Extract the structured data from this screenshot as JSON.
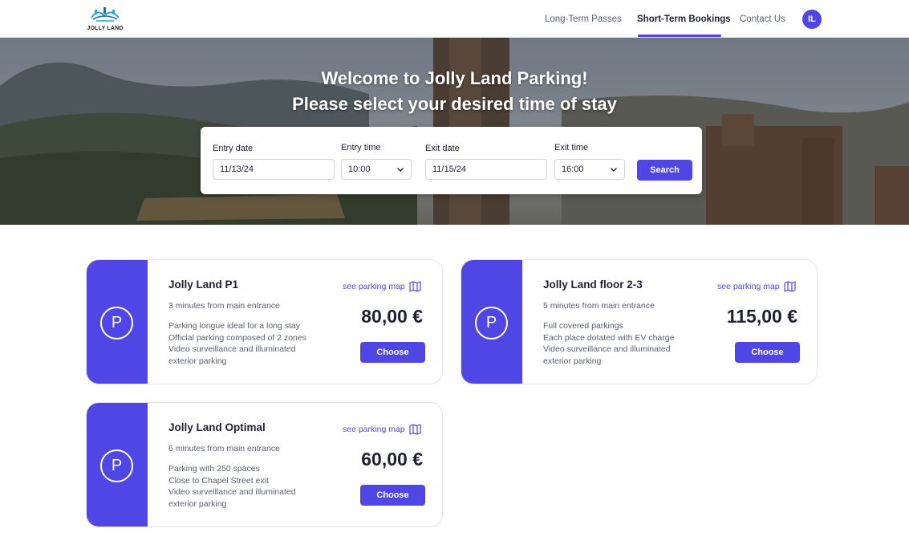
{
  "header": {
    "logo_text": "JOLLY LAND",
    "nav": [
      {
        "label": "Long-Term Passes"
      },
      {
        "label": "Short-Term Bookings"
      },
      {
        "label": "Contact Us"
      }
    ],
    "avatar_initials": "IL",
    "accent_color": "#4f46e5"
  },
  "hero": {
    "title_line1": "Welcome to Jolly Land Parking!",
    "title_line2": "Please select your desired time of stay"
  },
  "search": {
    "entry_date_label": "Entry date",
    "entry_date_value": "11/13/24",
    "entry_time_label": "Entry time",
    "entry_time_value": "10:00",
    "exit_date_label": "Exit date",
    "exit_date_value": "11/15/24",
    "exit_time_label": "Exit time",
    "exit_time_value": "16:00",
    "search_label": "Search"
  },
  "cards": [
    {
      "icon_letter": "P",
      "name": "Jolly Land P1",
      "map_link": "see parking map",
      "distance": "3 minutes from main entrance",
      "desc": [
        "Parking longue ideal for a long stay",
        "Official parking composed of 2 zones",
        "Video surveillance and illuminated",
        "exterior parking"
      ],
      "price": "80,00 €",
      "choose_label": "Choose"
    },
    {
      "icon_letter": "P",
      "name": "Jolly Land floor 2-3",
      "map_link": "see parking map",
      "distance": "5 minutes from main entrance",
      "desc": [
        "Full covered parkings",
        "Each place dotated with EV charge",
        "Video surveillance and illuminated",
        "exterior parking"
      ],
      "price": "115,00 €",
      "choose_label": "Choose"
    },
    {
      "icon_letter": "P",
      "name": "Jolly Land Optimal",
      "map_link": "see parking map",
      "distance": "6 minutes from main entrance",
      "desc": [
        "Parking with 250 spaces",
        "Close to Chapel Street exit",
        "Video surveillance and illuminated",
        "exterior parking"
      ],
      "price": "60,00 €",
      "choose_label": "Choose"
    }
  ]
}
